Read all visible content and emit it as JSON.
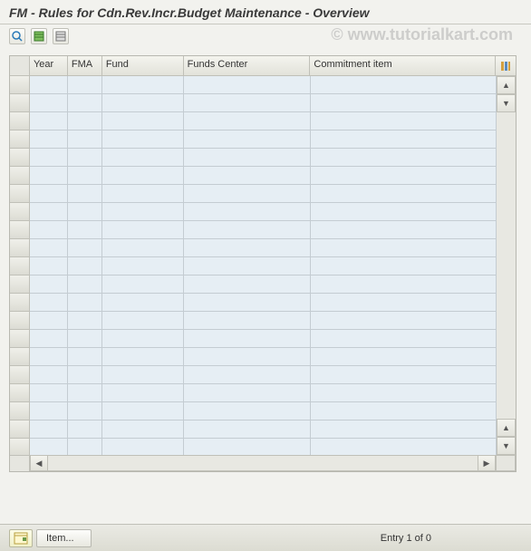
{
  "header": {
    "title": "FM - Rules for Cdn.Rev.Incr.Budget Maintenance - Overview"
  },
  "watermark": "© www.tutorialkart.com",
  "table": {
    "columns": [
      {
        "key": "year",
        "label": "Year"
      },
      {
        "key": "fma",
        "label": "FMA"
      },
      {
        "key": "fund",
        "label": "Fund"
      },
      {
        "key": "funds_center",
        "label": "Funds Center"
      },
      {
        "key": "commitment_item",
        "label": "Commitment item"
      }
    ],
    "rows": []
  },
  "footer": {
    "item_button_label": "Item...",
    "status": "Entry 1 of 0"
  }
}
